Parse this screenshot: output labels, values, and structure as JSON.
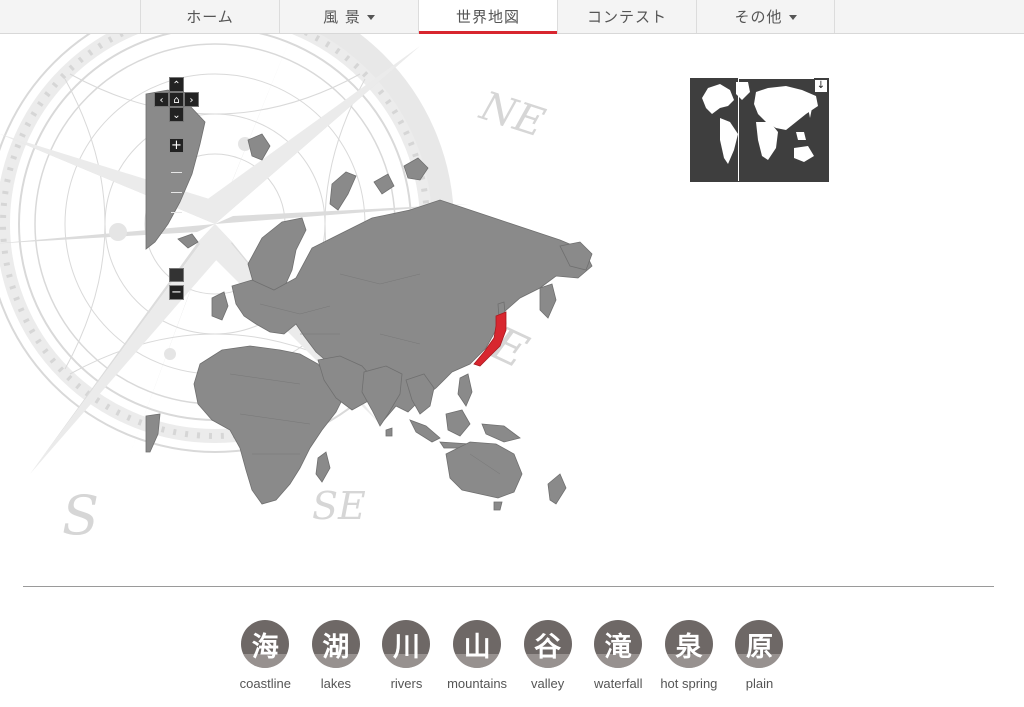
{
  "nav": {
    "items": [
      {
        "label": "ホーム",
        "dropdown": false,
        "active": false
      },
      {
        "label": "風 景",
        "dropdown": true,
        "active": false
      },
      {
        "label": "世界地図",
        "dropdown": false,
        "active": true
      },
      {
        "label": "コンテスト",
        "dropdown": false,
        "active": false
      },
      {
        "label": "その他",
        "dropdown": true,
        "active": false
      }
    ]
  },
  "compass_labels": {
    "ne": "NE",
    "e": "E",
    "se": "SE",
    "s": "S"
  },
  "map_controls": {
    "pan_up": "⌃",
    "pan_left": "‹",
    "pan_home": "⌂",
    "pan_right": "›",
    "pan_down": "⌄",
    "zoom_in": "+",
    "zoom_out": "−"
  },
  "overview_map": {
    "toggle": "↓"
  },
  "highlight_color": "#d8262f",
  "categories": [
    {
      "kanji": "海",
      "label": "coastline"
    },
    {
      "kanji": "湖",
      "label": "lakes"
    },
    {
      "kanji": "川",
      "label": "rivers"
    },
    {
      "kanji": "山",
      "label": "mountains"
    },
    {
      "kanji": "谷",
      "label": "valley"
    },
    {
      "kanji": "滝",
      "label": "waterfall"
    },
    {
      "kanji": "泉",
      "label": "hot spring"
    },
    {
      "kanji": "原",
      "label": "plain"
    }
  ]
}
